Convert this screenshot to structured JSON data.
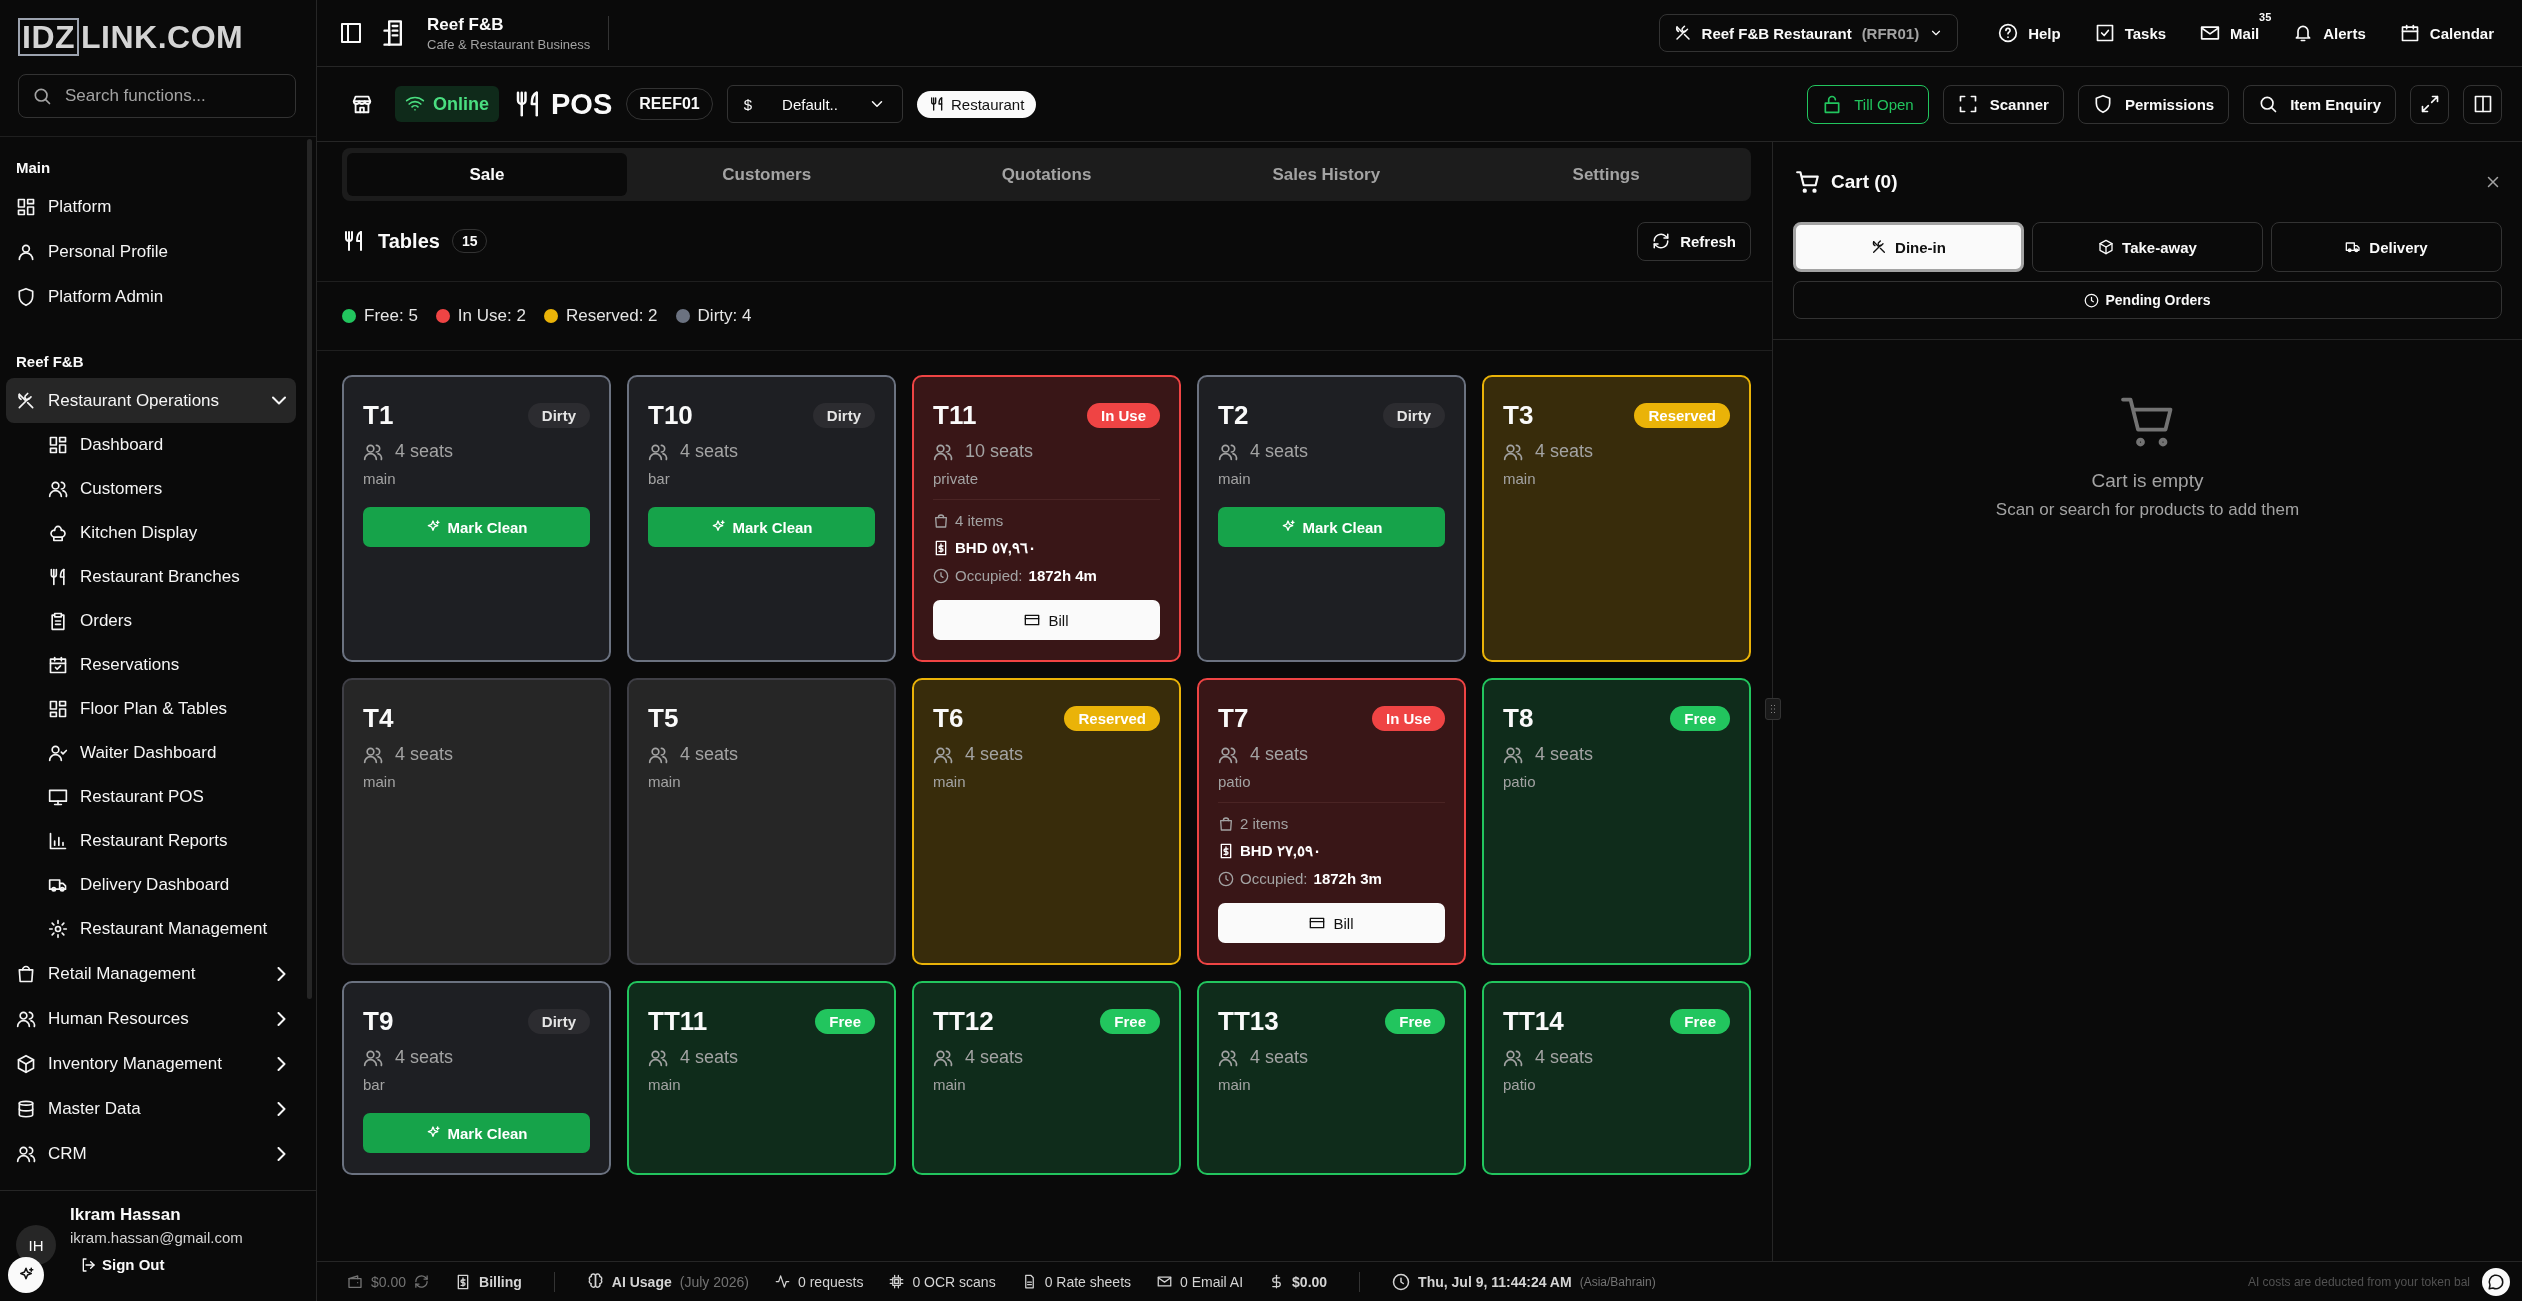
{
  "logo": {
    "boxed": "IDZ",
    "rest": "LINK.COM"
  },
  "sidebar": {
    "search": {
      "placeholder": "Search functions..."
    },
    "sections": [
      {
        "title": "Main",
        "items": [
          {
            "label": "Platform"
          },
          {
            "label": "Personal Profile"
          },
          {
            "label": "Platform Admin"
          }
        ]
      },
      {
        "title": "Reef F&B",
        "items": [
          {
            "label": "Restaurant Operations",
            "selected": true,
            "expanded": true,
            "children": [
              {
                "label": "Dashboard"
              },
              {
                "label": "Customers"
              },
              {
                "label": "Kitchen Display"
              },
              {
                "label": "Restaurant Branches"
              },
              {
                "label": "Orders"
              },
              {
                "label": "Reservations"
              },
              {
                "label": "Floor Plan & Tables"
              },
              {
                "label": "Waiter Dashboard"
              },
              {
                "label": "Restaurant POS"
              },
              {
                "label": "Restaurant Reports"
              },
              {
                "label": "Delivery Dashboard"
              },
              {
                "label": "Restaurant Management"
              }
            ]
          },
          {
            "label": "Retail Management",
            "selected": false,
            "expanded": false
          },
          {
            "label": "Human Resources",
            "selected": false,
            "expanded": false
          },
          {
            "label": "Inventory Management",
            "selected": false,
            "expanded": false
          },
          {
            "label": "Master Data",
            "selected": false,
            "expanded": false
          },
          {
            "label": "CRM",
            "selected": false,
            "expanded": false
          }
        ]
      }
    ]
  },
  "user": {
    "initials": "IH",
    "name": "Ikram Hassan",
    "email": "ikram.hassan@gmail.com",
    "sign_out": "Sign Out"
  },
  "topbar": {
    "title": "Reef F&B",
    "subtitle": "Cafe & Restaurant Business",
    "branch": {
      "name": "Reef F&B Restaurant",
      "code": "(RFR01)"
    },
    "links": [
      {
        "label": "Help"
      },
      {
        "label": "Tasks"
      },
      {
        "label": "Mail",
        "badge": "35"
      },
      {
        "label": "Alerts"
      },
      {
        "label": "Calendar"
      }
    ]
  },
  "pos_toolbar": {
    "status": "Online",
    "title": "POS",
    "terminal": "REEF01",
    "currency": {
      "symbol": "$",
      "value": "Default.."
    },
    "mode": "Restaurant",
    "actions": [
      {
        "label": "Till Open",
        "kind": "till"
      },
      {
        "label": "Scanner",
        "kind": "tool"
      },
      {
        "label": "Permissions",
        "kind": "tool"
      },
      {
        "label": "Item Enquiry",
        "kind": "tool"
      }
    ]
  },
  "tabs": [
    {
      "label": "Sale",
      "selected": true
    },
    {
      "label": "Customers",
      "selected": false
    },
    {
      "label": "Quotations",
      "selected": false
    },
    {
      "label": "Sales History",
      "selected": false
    },
    {
      "label": "Settings",
      "selected": false
    }
  ],
  "tables_panel": {
    "title": "Tables",
    "count": "15",
    "refresh": "Refresh",
    "legend": [
      {
        "label": "Free: 5",
        "color": "#22c55e"
      },
      {
        "label": "In Use: 2",
        "color": "#ef4444"
      },
      {
        "label": "Reserved: 2",
        "color": "#eab308"
      },
      {
        "label": "Dirty: 4",
        "color": "#6b7280"
      }
    ],
    "tables": [
      {
        "name": "T1",
        "kind": "dirty",
        "badge": "Dirty",
        "seats": "4 seats",
        "area": "main",
        "action": "Mark Clean"
      },
      {
        "name": "T10",
        "kind": "dirty",
        "badge": "Dirty",
        "seats": "4 seats",
        "area": "bar",
        "action": "Mark Clean"
      },
      {
        "name": "T11",
        "kind": "in_use",
        "badge": "In Use",
        "seats": "10 seats",
        "area": "private",
        "items": "4 items",
        "amount": "BHD ٥٧,٩٦٠",
        "occupied_label": "Occupied:",
        "occupied": "1872h 4m",
        "action": "Bill"
      },
      {
        "name": "T2",
        "kind": "dirty",
        "badge": "Dirty",
        "seats": "4 seats",
        "area": "main",
        "action": "Mark Clean"
      },
      {
        "name": "T3",
        "kind": "reserved",
        "badge": "Reserved",
        "seats": "4 seats",
        "area": "main"
      },
      {
        "name": "T4",
        "kind": "plain",
        "seats": "4 seats",
        "area": "main"
      },
      {
        "name": "T5",
        "kind": "plain",
        "seats": "4 seats",
        "area": "main"
      },
      {
        "name": "T6",
        "kind": "reserved",
        "badge": "Reserved",
        "seats": "4 seats",
        "area": "main"
      },
      {
        "name": "T7",
        "kind": "in_use",
        "badge": "In Use",
        "seats": "4 seats",
        "area": "patio",
        "items": "2 items",
        "amount": "BHD ٢٧,٥٩٠",
        "occupied_label": "Occupied:",
        "occupied": "1872h 3m",
        "action": "Bill"
      },
      {
        "name": "T8",
        "kind": "free",
        "badge": "Free",
        "seats": "4 seats",
        "area": "patio"
      },
      {
        "name": "T9",
        "kind": "dirty",
        "badge": "Dirty",
        "seats": "4 seats",
        "area": "bar",
        "action": "Mark Clean"
      },
      {
        "name": "TT11",
        "kind": "free",
        "badge": "Free",
        "seats": "4 seats",
        "area": "main"
      },
      {
        "name": "TT12",
        "kind": "free",
        "badge": "Free",
        "seats": "4 seats",
        "area": "main"
      },
      {
        "name": "TT13",
        "kind": "free",
        "badge": "Free",
        "seats": "4 seats",
        "area": "main"
      },
      {
        "name": "TT14",
        "kind": "free",
        "badge": "Free",
        "seats": "4 seats",
        "area": "patio"
      }
    ]
  },
  "cart": {
    "title": "Cart (0)",
    "order_types": [
      {
        "label": "Dine-in",
        "selected": true
      },
      {
        "label": "Take-away",
        "selected": false
      },
      {
        "label": "Delivery",
        "selected": false
      }
    ],
    "pending": "Pending Orders",
    "empty_title": "Cart is empty",
    "empty_hint": "Scan or search for products to add them"
  },
  "status_bar": {
    "balance": "$0.00",
    "billing": "Billing",
    "ai_usage": "AI Usage",
    "period": "(July 2026)",
    "stats": [
      "0 requests",
      "0 OCR scans",
      "0 Rate sheets",
      "0 Email AI"
    ],
    "cost": "$0.00",
    "datetime": "Thu, Jul 9, 11:44:24 AM",
    "timezone": "(Asia/Bahrain)",
    "note": "AI costs are deducted from your token bal"
  }
}
